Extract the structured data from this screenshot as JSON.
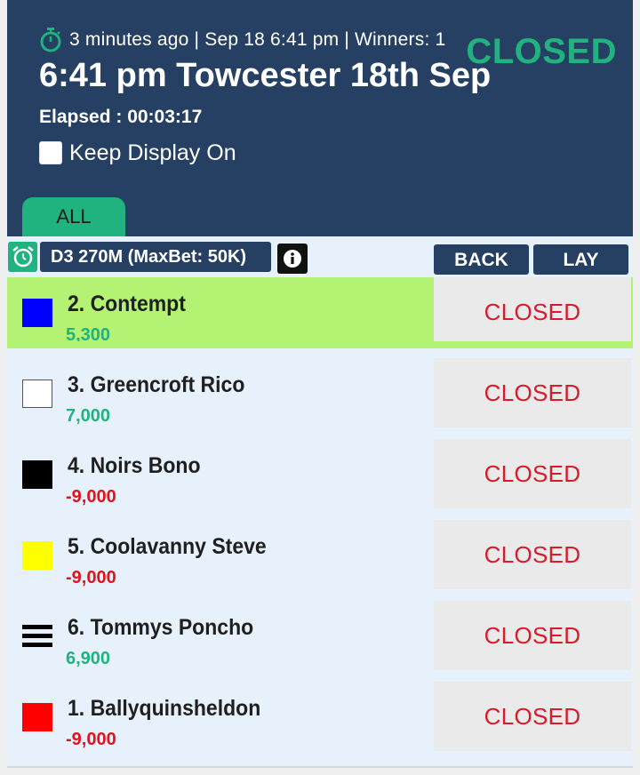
{
  "header": {
    "meta": "3 minutes ago | Sep 18 6:41 pm | Winners: 1",
    "status": "CLOSED",
    "title": "6:41 pm Towcester 18th Sep",
    "elapsed": "Elapsed : 00:03:17",
    "keep_display_label": "Keep Display On",
    "keep_display_checked": false,
    "tab_all": "ALL"
  },
  "market": {
    "name": "D3 270M (MaxBet: 50K)",
    "back_label": "BACK",
    "lay_label": "LAY"
  },
  "colors": {
    "header_bg": "#254063",
    "accent_green": "#20b27f",
    "winner_bg": "#b3f272",
    "closed_red": "#d81b2a",
    "loss_red": "#e0141e"
  },
  "runners": [
    {
      "name": "2. Contempt",
      "pl": "5,300",
      "price": "CLOSED",
      "silk": "blue",
      "winner": true
    },
    {
      "name": "3. Greencroft Rico",
      "pl": "7,000",
      "price": "CLOSED",
      "silk": "white",
      "winner": false
    },
    {
      "name": "4. Noirs Bono",
      "pl": "-9,000",
      "price": "CLOSED",
      "silk": "black",
      "winner": false
    },
    {
      "name": "5. Coolavanny Steve",
      "pl": "-9,000",
      "price": "CLOSED",
      "silk": "yellow",
      "winner": false
    },
    {
      "name": "6. Tommys Poncho",
      "pl": "6,900",
      "price": "CLOSED",
      "silk": "black-white-stripes",
      "winner": false
    },
    {
      "name": "1. Ballyquinsheldon",
      "pl": "-9,000",
      "price": "CLOSED",
      "silk": "red",
      "winner": false
    }
  ]
}
